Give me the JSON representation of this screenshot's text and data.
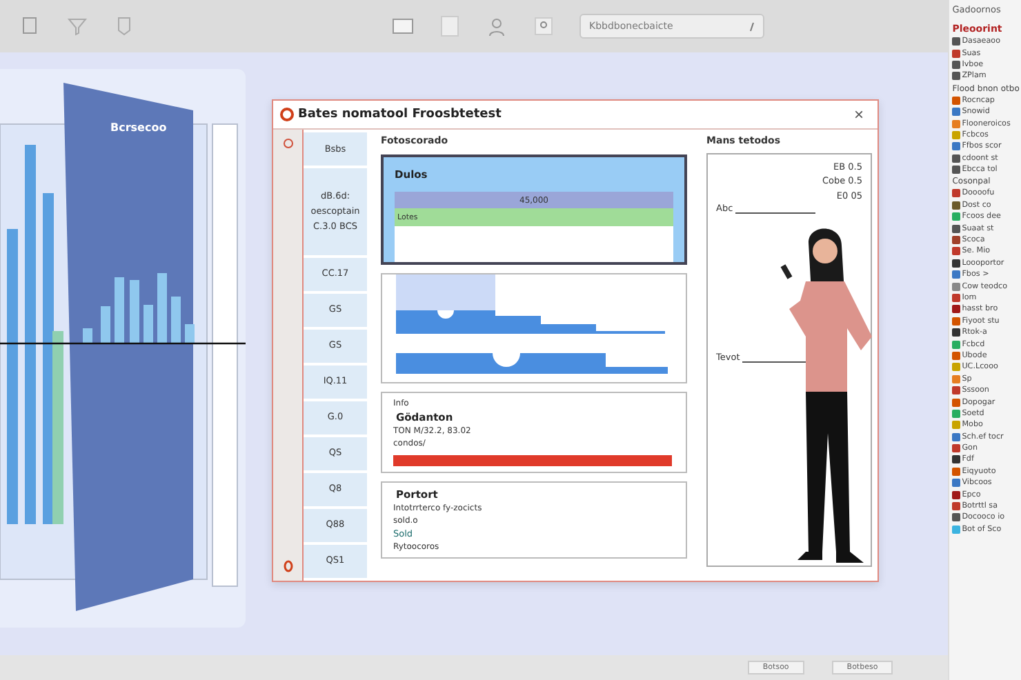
{
  "toolbar": {
    "search": {
      "value": "Kbbdbonecbaicte"
    }
  },
  "left_card": {
    "slab_title": "Bcrsecoo"
  },
  "dialog": {
    "title": "Bates nomatool Froosbtetest",
    "close": "×",
    "list": [
      {
        "label": "Bsbs"
      },
      {
        "label": "dB.6d: oescoptain C.3.0 BCS"
      },
      {
        "label": "CC.17"
      },
      {
        "label": "GS"
      },
      {
        "label": "GS"
      },
      {
        "label": "IQ.11"
      },
      {
        "label": "G.0"
      },
      {
        "label": "QS"
      },
      {
        "label": "Q8"
      },
      {
        "label": "Q88"
      },
      {
        "label": "QS1"
      }
    ],
    "main": {
      "heading": "Fotoscorado",
      "summary": {
        "title": "Dulos",
        "bar_value": "45,000",
        "bar_label": "Lotes"
      },
      "info": {
        "label": "Info",
        "title": "Gödanton",
        "line": "TON M/32.2, 83.02",
        "note": "condos/",
        "level": 1
      },
      "report": {
        "title": "Portort",
        "line": "Intotrrterco fy-zocicts",
        "note": "sold.o",
        "link": "Sold",
        "footer": "Rytoocoros"
      }
    },
    "right": {
      "heading": "Mans tetodos",
      "values": [
        "EB 0.5",
        "Cobe 0.5",
        "E0 05"
      ],
      "fields": [
        "Abc",
        "Tevot"
      ]
    }
  },
  "side_panel": {
    "header": "Gadoornos",
    "sections": [
      {
        "kind": "primary",
        "title": "Pleoorint",
        "items": [
          {
            "label": "Dasaeaoo",
            "color": "#555555"
          },
          {
            "label": "Suas",
            "color": "#c0392b"
          },
          {
            "label": "Ivboe",
            "color": "#555555"
          },
          {
            "label": "ZPlam",
            "color": "#555555"
          }
        ]
      },
      {
        "kind": "plain",
        "title": "Flood bnon otbo",
        "items": [
          {
            "label": "Rocncap",
            "color": "#d35400"
          },
          {
            "label": "Snowid",
            "color": "#3b78c4"
          },
          {
            "label": "Flooneroicos",
            "color": "#e67e22"
          },
          {
            "label": "Fcbcos",
            "color": "#c9a400"
          },
          {
            "label": "Ffbos scor",
            "color": "#3b78c4"
          },
          {
            "label": "cdoont st",
            "color": "#555555"
          },
          {
            "label": "Ebcca tol",
            "color": "#555555"
          }
        ]
      },
      {
        "kind": "plain",
        "title": "Cosonpal",
        "items": [
          {
            "label": "Doooofu",
            "color": "#c0392b"
          },
          {
            "label": "Dost co",
            "color": "#6b5a2a"
          },
          {
            "label": "Fcoos dee",
            "color": "#27ae60"
          },
          {
            "label": "Suaat st",
            "color": "#555555"
          },
          {
            "label": "Scoca",
            "color": "#a0402a"
          },
          {
            "label": "Se. Mio",
            "color": "#c0392b"
          },
          {
            "label": "Loooportor",
            "color": "#333333"
          },
          {
            "label": "Fbos >",
            "color": "#3b78c4"
          },
          {
            "label": "Cow teodco",
            "color": "#888888"
          },
          {
            "label": "Iom",
            "color": "#c0392b"
          },
          {
            "label": "hasst bro",
            "color": "#a01818"
          },
          {
            "label": "Fiyoot stu",
            "color": "#d35400"
          },
          {
            "label": "Rtok-a",
            "color": "#333333"
          },
          {
            "label": "Fcbcd",
            "color": "#27ae60"
          },
          {
            "label": "Ubode",
            "color": "#d35400"
          },
          {
            "label": "UC.Lcooo",
            "color": "#c9a400"
          },
          {
            "label": "Sp",
            "color": "#e67e22"
          },
          {
            "label": "Sssoon",
            "color": "#c0392b"
          },
          {
            "label": "Dopogar",
            "color": "#d35400"
          },
          {
            "label": "Soetd",
            "color": "#27ae60"
          },
          {
            "label": "Mobo",
            "color": "#c9a400"
          },
          {
            "label": "Sch.ef tocr",
            "color": "#3b78c4"
          },
          {
            "label": "Gon",
            "color": "#c0392b"
          },
          {
            "label": "Fdf",
            "color": "#333333"
          },
          {
            "label": "Eiqyuoto",
            "color": "#d35400"
          },
          {
            "label": "Vibcoos",
            "color": "#3b78c4"
          },
          {
            "label": "Epco",
            "color": "#a01818"
          },
          {
            "label": "Botrttl sa",
            "color": "#c0392b"
          },
          {
            "label": "Docooco io",
            "color": "#555555"
          },
          {
            "label": "Bot of Sco",
            "color": "#3bb3e0"
          }
        ]
      }
    ]
  },
  "footer": {
    "buttons": [
      "Botsoo",
      "Botbeso"
    ]
  }
}
